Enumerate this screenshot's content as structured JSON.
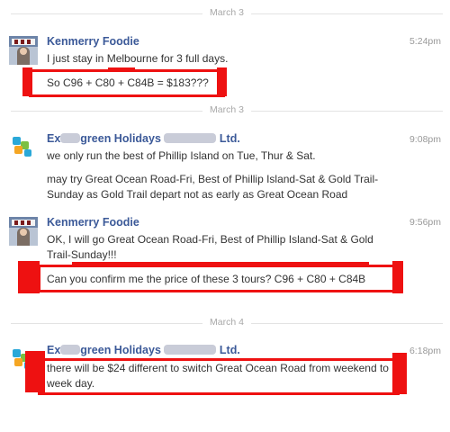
{
  "dates": {
    "first": "March 3",
    "second": "March 3",
    "third": "March 4"
  },
  "messages": [
    {
      "sender": "Kenmerry Foodie",
      "time": "5:24pm",
      "lines": [
        "I just stay in Melbourne for 3 full days.",
        "So C96 + C80 + C84B = $183???"
      ]
    },
    {
      "sender_left": "Ex",
      "sender_mid": "green Holidays",
      "sender_right": "Ltd.",
      "time": "9:08pm",
      "lines": [
        "we only run the best of Phillip Island on Tue, Thur & Sat.",
        "may try Great Ocean Road-Fri, Best of Phillip Island-Sat & Gold Trail-Sunday as Gold Trail depart not as early as Great Ocean Road"
      ]
    },
    {
      "sender": "Kenmerry Foodie",
      "time": "9:56pm",
      "lines": [
        "OK, I will go Great Ocean Road-Fri, Best of Phillip Island-Sat & Gold Trail-Sunday!!!",
        "Can you confirm me the price of these 3 tours? C96 + C80 + C84B"
      ]
    },
    {
      "sender_left": "Ex",
      "sender_mid": "green Holidays",
      "sender_right": "Ltd.",
      "time": "6:18pm",
      "lines": [
        "there will be $24 different to switch Great Ocean Road from weekend to week day."
      ]
    }
  ],
  "colors": {
    "sender": "#3b5998",
    "highlight": "#ee1111",
    "text": "#333333",
    "meta": "#999999"
  },
  "icons": {
    "avatar_user": "foodie-photo",
    "avatar_company": "company-logo"
  }
}
